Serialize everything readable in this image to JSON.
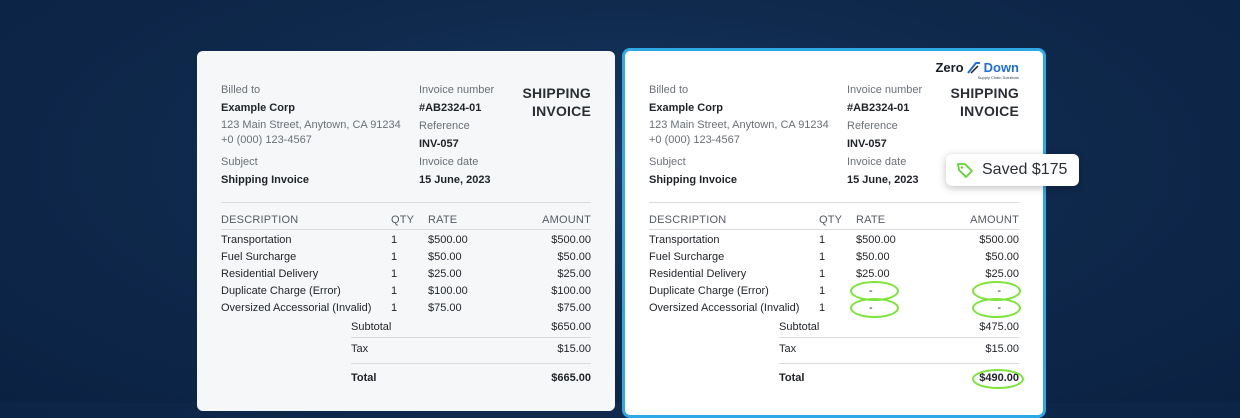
{
  "original": {
    "billed_to_label": "Billed to",
    "billed_to_name": "Example Corp",
    "address": "123 Main Street, Anytown, CA 91234",
    "phone": "+0 (000) 123-4567",
    "subject_label": "Subject",
    "subject_value": "Shipping Invoice",
    "invoice_number_label": "Invoice number",
    "invoice_number": "#AB2324-01",
    "reference_label": "Reference",
    "reference": "INV-057",
    "invoice_date_label": "Invoice date",
    "invoice_date": "15 June, 2023",
    "title_line1": "SHIPPING",
    "title_line2": "INVOICE",
    "headers": {
      "description": "DESCRIPTION",
      "qty": "QTY",
      "rate": "RATE",
      "amount": "AMOUNT"
    },
    "rows": [
      {
        "desc": "Transportation",
        "qty": "1",
        "rate": "$500.00",
        "amount": "$500.00"
      },
      {
        "desc": "Fuel Surcharge",
        "qty": "1",
        "rate": "$50.00",
        "amount": "$50.00"
      },
      {
        "desc": "Residential Delivery",
        "qty": "1",
        "rate": "$25.00",
        "amount": "$25.00"
      },
      {
        "desc": "Duplicate Charge (Error)",
        "qty": "1",
        "rate": "$100.00",
        "amount": "$100.00"
      },
      {
        "desc": "Oversized Accessorial (Invalid)",
        "qty": "1",
        "rate": "$75.00",
        "amount": "$75.00"
      }
    ],
    "subtotal_label": "Subtotal",
    "subtotal": "$650.00",
    "tax_label": "Tax",
    "tax": "$15.00",
    "total_label": "Total",
    "total": "$665.00"
  },
  "audited": {
    "logo_zero": "Zero",
    "logo_down": "Down",
    "logo_tagline": "Supply Chain Solutions",
    "billed_to_label": "Billed to",
    "billed_to_name": "Example Corp",
    "address": "123 Main Street, Anytown, CA 91234",
    "phone": "+0 (000) 123-4567",
    "subject_label": "Subject",
    "subject_value": "Shipping Invoice",
    "invoice_number_label": "Invoice number",
    "invoice_number": "#AB2324-01",
    "reference_label": "Reference",
    "reference": "INV-057",
    "invoice_date_label": "Invoice date",
    "invoice_date": "15 June, 2023",
    "title_line1": "SHIPPING",
    "title_line2": "INVOICE",
    "headers": {
      "description": "DESCRIPTION",
      "qty": "QTY",
      "rate": "RATE",
      "amount": "AMOUNT"
    },
    "rows": [
      {
        "desc": "Transportation",
        "qty": "1",
        "rate": "$500.00",
        "amount": "$500.00"
      },
      {
        "desc": "Fuel Surcharge",
        "qty": "1",
        "rate": "$50.00",
        "amount": "$50.00"
      },
      {
        "desc": "Residential Delivery",
        "qty": "1",
        "rate": "$25.00",
        "amount": "$25.00"
      },
      {
        "desc": "Duplicate Charge (Error)",
        "qty": "1",
        "rate": "-",
        "amount": "-"
      },
      {
        "desc": "Oversized Accessorial (Invalid)",
        "qty": "1",
        "rate": "-",
        "amount": "-"
      }
    ],
    "subtotal_label": "Subtotal",
    "subtotal": "$475.00",
    "tax_label": "Tax",
    "tax": "$15.00",
    "total_label": "Total",
    "total": "$490.00"
  },
  "badge": {
    "text": "Saved $175",
    "icon": "tag-icon"
  },
  "colors": {
    "highlight": "#7ee33a",
    "accent_border": "#2fa8e6",
    "background": "#0f2a4d"
  }
}
